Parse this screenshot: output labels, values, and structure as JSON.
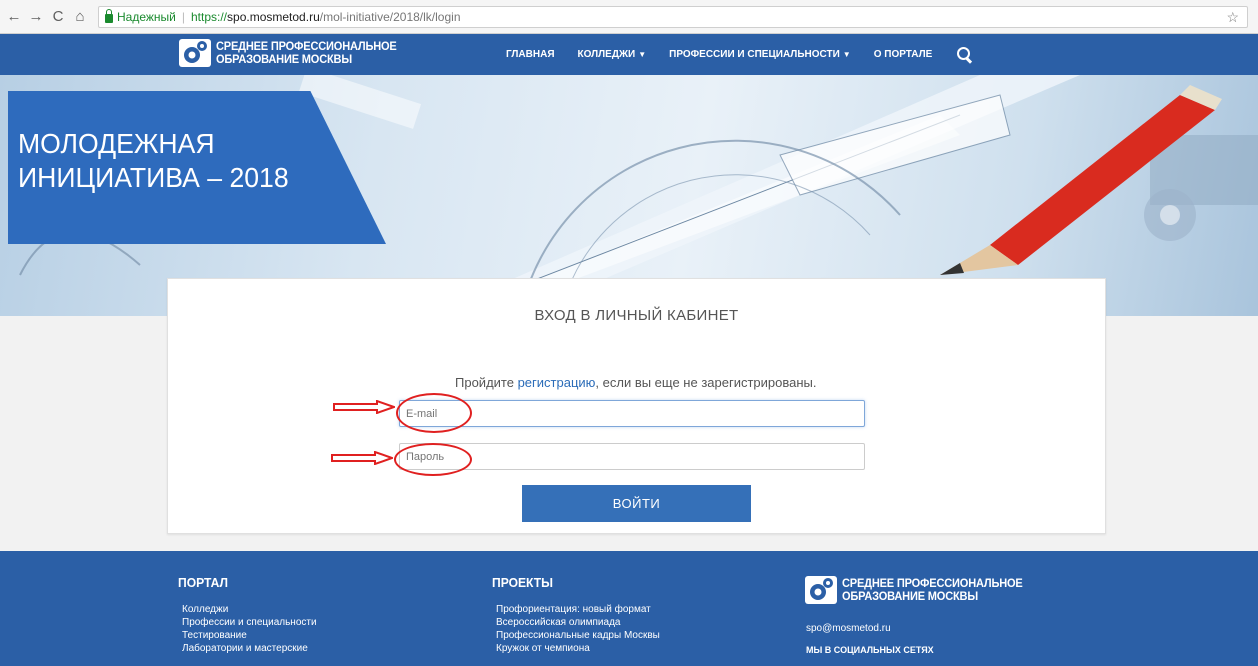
{
  "browser": {
    "secure_label": "Надежный",
    "url_scheme": "https://",
    "url_host": "spo.mosmetod.ru",
    "url_path": "/mol-initiative/2018/lk/login"
  },
  "header": {
    "logo_line1": "СРЕДНЕЕ ПРОФЕССИОНАЛЬНОЕ",
    "logo_line2": "ОБРАЗОВАНИЕ МОСКВЫ",
    "nav": {
      "home": "ГЛАВНАЯ",
      "colleges": "КОЛЛЕДЖИ",
      "professions": "ПРОФЕССИИ И СПЕЦИАЛЬНОСТИ",
      "about": "О ПОРТАЛЕ"
    }
  },
  "hero": {
    "title_line1": "МОЛОДЕЖНАЯ",
    "title_line2": "ИНИЦИАТИВА – 2018"
  },
  "login": {
    "title": "ВХОД В ЛИЧНЫЙ КАБИНЕТ",
    "register_prefix": "Пройдите ",
    "register_link": "регистрацию",
    "register_suffix": ", если вы еще не зарегистрированы.",
    "email_placeholder": "E-mail",
    "password_placeholder": "Пароль",
    "submit_label": "ВОЙТИ"
  },
  "footer": {
    "portal_title": "ПОРТАЛ",
    "portal_links": [
      "Колледжи",
      "Профессии и специальности",
      "Тестирование",
      "Лаборатории и мастерские"
    ],
    "projects_title": "ПРОЕКТЫ",
    "projects_links": [
      "Профориентация: новый формат",
      "Всероссийская олимпиада",
      "Профессиональные кадры Москвы",
      "Кружок от чемпиона"
    ],
    "logo_line1": "СРЕДНЕЕ ПРОФЕССИОНАЛЬНОЕ",
    "logo_line2": "ОБРАЗОВАНИЕ МОСКВЫ",
    "email": "spo@mosmetod.ru",
    "social_label": "МЫ В СОЦИАЛЬНЫХ СЕТЯХ"
  },
  "colors": {
    "brand_blue": "#2b5fa6",
    "button_blue": "#3570b8",
    "annotation_red": "#e02020"
  },
  "icons": [
    "back-arrow-icon",
    "forward-arrow-icon",
    "reload-icon",
    "home-icon",
    "lock-icon",
    "bookmark-star-icon",
    "gear-logo-icon",
    "search-icon"
  ]
}
